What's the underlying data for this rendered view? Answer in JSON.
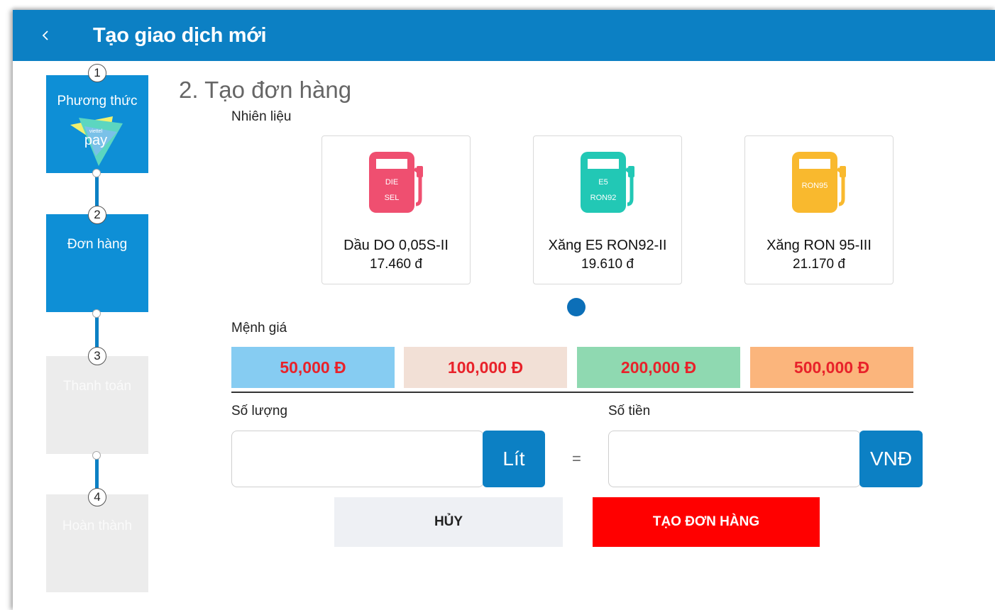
{
  "header": {
    "back_icon": "chevron-left-icon",
    "title": "Tạo giao dịch mới"
  },
  "steps": [
    {
      "number": "1",
      "label": "Phương thức",
      "state": "completed",
      "logo_text": "pay",
      "logo_small": "viettel"
    },
    {
      "number": "2",
      "label": "Đơn hàng",
      "state": "active"
    },
    {
      "number": "3",
      "label": "Thanh toán",
      "state": "inactive"
    },
    {
      "number": "4",
      "label": "Hoàn thành",
      "state": "inactive"
    }
  ],
  "main": {
    "section_title": "2. Tạo đơn hàng",
    "fuel_label": "Nhiên liệu",
    "fuels": [
      {
        "name": "Dầu DO 0,05S-II",
        "price": "17.460 đ",
        "icon": "fuel-pump-icon",
        "icon_text_1": "DIE",
        "icon_text_2": "SEL",
        "color": "#ef4f70"
      },
      {
        "name": "Xăng E5 RON92-II",
        "price": "19.610 đ",
        "icon": "fuel-pump-icon",
        "icon_text_1": "E5",
        "icon_text_2": "RON92",
        "color": "#22c8b5"
      },
      {
        "name": "Xăng RON 95-III",
        "price": "21.170 đ",
        "icon": "fuel-pump-icon",
        "icon_text_1": "",
        "icon_text_2": "RON95",
        "color": "#f9b92e"
      }
    ],
    "denomination_label": "Mệnh giá",
    "denominations": [
      {
        "label": "50,000 Đ",
        "bg": "#86ccf2"
      },
      {
        "label": "100,000 Đ",
        "bg": "#f2e0d6"
      },
      {
        "label": "200,000 Đ",
        "bg": "#8fd9b1"
      },
      {
        "label": "500,000 Đ",
        "bg": "#fbb57c"
      }
    ],
    "quantity_label": "Số lượng",
    "quantity_value": "",
    "quantity_unit": "Lít",
    "equals": "=",
    "amount_label": "Số tiền",
    "amount_value": "",
    "amount_unit": "VNĐ",
    "cancel_label": "HỦY",
    "create_label": "TẠO ĐƠN HÀNG"
  },
  "colors": {
    "primary": "#0c80c4",
    "danger": "#ff0000",
    "denom_text": "#e8222a"
  }
}
